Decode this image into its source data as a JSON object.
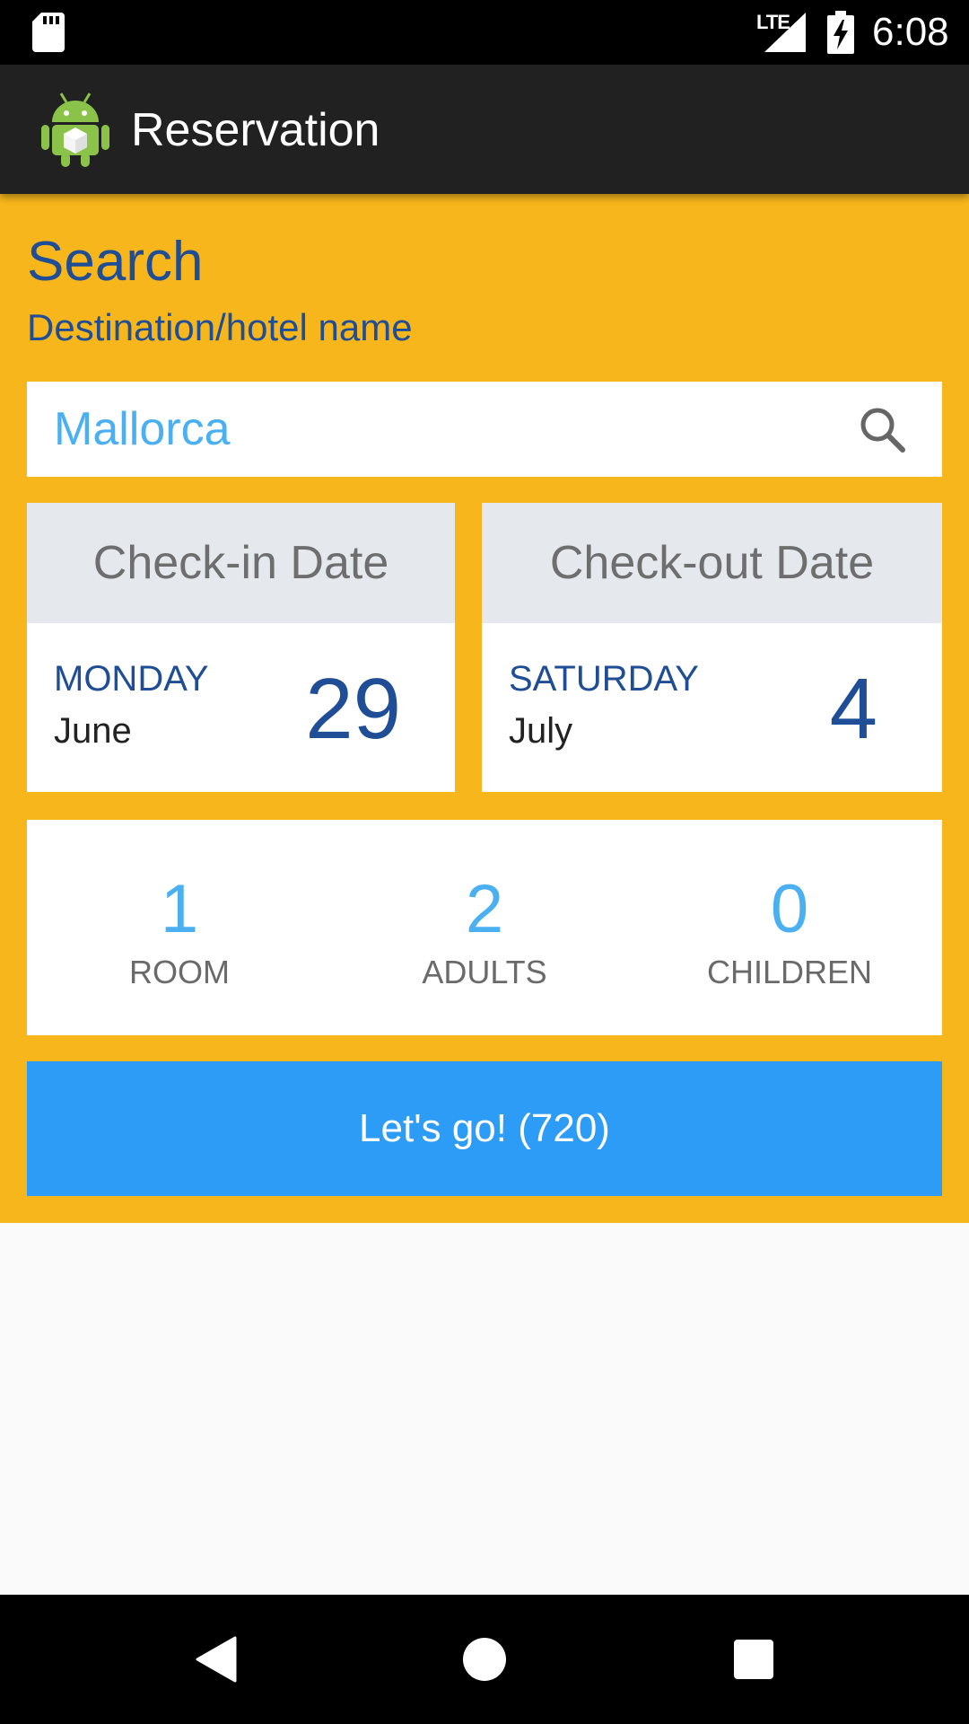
{
  "status_bar": {
    "time": "6:08",
    "network": "LTE"
  },
  "app_bar": {
    "title": "Reservation"
  },
  "search": {
    "title": "Search",
    "subtitle": "Destination/hotel name",
    "value": "Mallorca"
  },
  "checkin": {
    "header": "Check-in Date",
    "weekday": "MONDAY",
    "month": "June",
    "day": "29"
  },
  "checkout": {
    "header": "Check-out Date",
    "weekday": "SATURDAY",
    "month": "July",
    "day": "4"
  },
  "guests": [
    {
      "count": "1",
      "label": "ROOM"
    },
    {
      "count": "2",
      "label": "ADULTS"
    },
    {
      "count": "0",
      "label": "CHILDREN"
    }
  ],
  "action": {
    "go_label": "Let's go! (720)"
  },
  "colors": {
    "panel_background": "#f7b71c",
    "primary_dark_blue": "#1f4e96",
    "accent_light_blue": "#4ab0f2",
    "button_blue": "#2d9cf6",
    "app_bar": "#212121"
  },
  "icons": [
    "sd-card-icon",
    "signal-icon",
    "battery-charging-icon",
    "android-app-icon",
    "search-icon",
    "back-icon",
    "home-icon",
    "recents-icon"
  ]
}
